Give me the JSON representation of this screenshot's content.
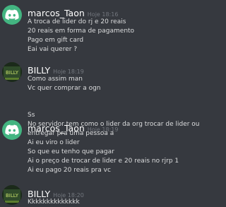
{
  "messages": [
    {
      "author": "marcos_Taon",
      "time": "Hoje 18:16",
      "avatar_icon": "discord-logo-icon",
      "lines": [
        "A troca de lider do rj e 20 reais",
        "20 reais em forma de pagamento",
        "Pago em gift card",
        "Eai vai querer ?"
      ]
    },
    {
      "author": "BILLY",
      "time": "Hoje 18:19",
      "avatar_icon": "billy-avatar-icon",
      "lines": [
        "Como assim man",
        "Vc quer comprar a ogn"
      ]
    },
    {
      "author": "marcos_Taon",
      "time": "Hoje 18:19",
      "avatar_icon": "discord-logo-icon",
      "lines": [
        "Ss",
        "No servidor tem como o lider da org trocar de lider ou",
        "entregar pra uma pessoa a",
        "Ai eu viro o lider",
        "So que eu tenho que pagar",
        "Ai o preço de trocar de lider e 20 reais no rjrp 1",
        "Ai eu pago 20 reais pra vc"
      ]
    },
    {
      "author": "BILLY",
      "time": "Hoje 18:20",
      "avatar_icon": "billy-avatar-icon",
      "lines": [
        "Kkkkkkkkkkkkkk"
      ]
    }
  ],
  "colors": {
    "background": "#36393f",
    "username": "#ffffff",
    "timestamp": "#72767d",
    "text": "#dcddde",
    "discord_avatar": "#43b581"
  }
}
